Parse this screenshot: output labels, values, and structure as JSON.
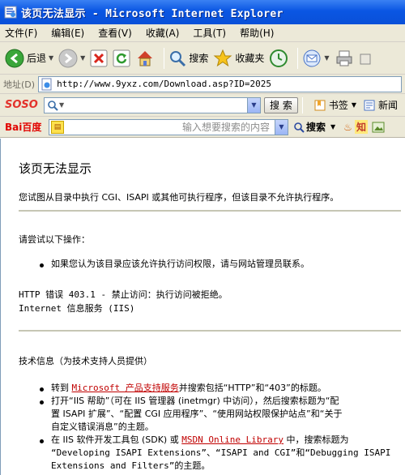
{
  "window": {
    "title": "该页无法显示 - Microsoft Internet Explorer"
  },
  "menu": [
    {
      "label": "文件(F)"
    },
    {
      "label": "编辑(E)"
    },
    {
      "label": "查看(V)"
    },
    {
      "label": "收藏(A)"
    },
    {
      "label": "工具(T)"
    },
    {
      "label": "帮助(H)"
    }
  ],
  "toolbar": {
    "back_label": "后退",
    "search_label": "搜索",
    "favorites_label": "收藏夹"
  },
  "address": {
    "label": "地址(D)",
    "url": "http://www.9yxz.com/Download.asp?ID=2025"
  },
  "soso": {
    "logo_left": "SO",
    "logo_right": "SO",
    "search_button": "搜 索",
    "bookmark_label": "书签",
    "news_label": "新闻"
  },
  "baidu": {
    "logo_left": "Bai",
    "logo_right": "百度",
    "placeholder": "输入想要搜索的内容",
    "search_button": "搜索",
    "zhidao_label": "知"
  },
  "page": {
    "title": "该页无法显示",
    "intro": "您试图从目录中执行 CGI、ISAPI 或其他可执行程序，但该目录不允许执行程序。",
    "try_heading": "请尝试以下操作：",
    "try_item": "如果您认为该目录应该允许执行访问权限，请与网站管理员联系。",
    "error_line1": "HTTP 错误 403.1 - 禁止访问：执行访问被拒绝。",
    "error_line2": "Internet 信息服务 (IIS)",
    "tech_heading": "技术信息（为技术支持人员提供）",
    "tech_items": [
      {
        "before": "转到 ",
        "link": "Microsoft 产品支持服务",
        "after": "并搜索包括“HTTP”和“403”的标题。"
      },
      {
        "line1": "打开“IIS 帮助”（可在 IIS 管理器 (inetmgr) 中访问），然后搜索标题为“配",
        "line2": "置 ISAPI 扩展”、“配置 CGI 应用程序”、“使用网站权限保护站点”和“关于",
        "line3": "自定义错误消息”的主题。"
      },
      {
        "before": "在 IIS 软件开发工具包 (SDK) 或 ",
        "link": "MSDN Online Library",
        "after": " 中，搜索标题为",
        "line2": "“Developing ISAPI Extensions”、“ISAPI and CGI”和“Debugging ISAPI",
        "line3": "Extensions and Filters”的主题。"
      }
    ]
  }
}
